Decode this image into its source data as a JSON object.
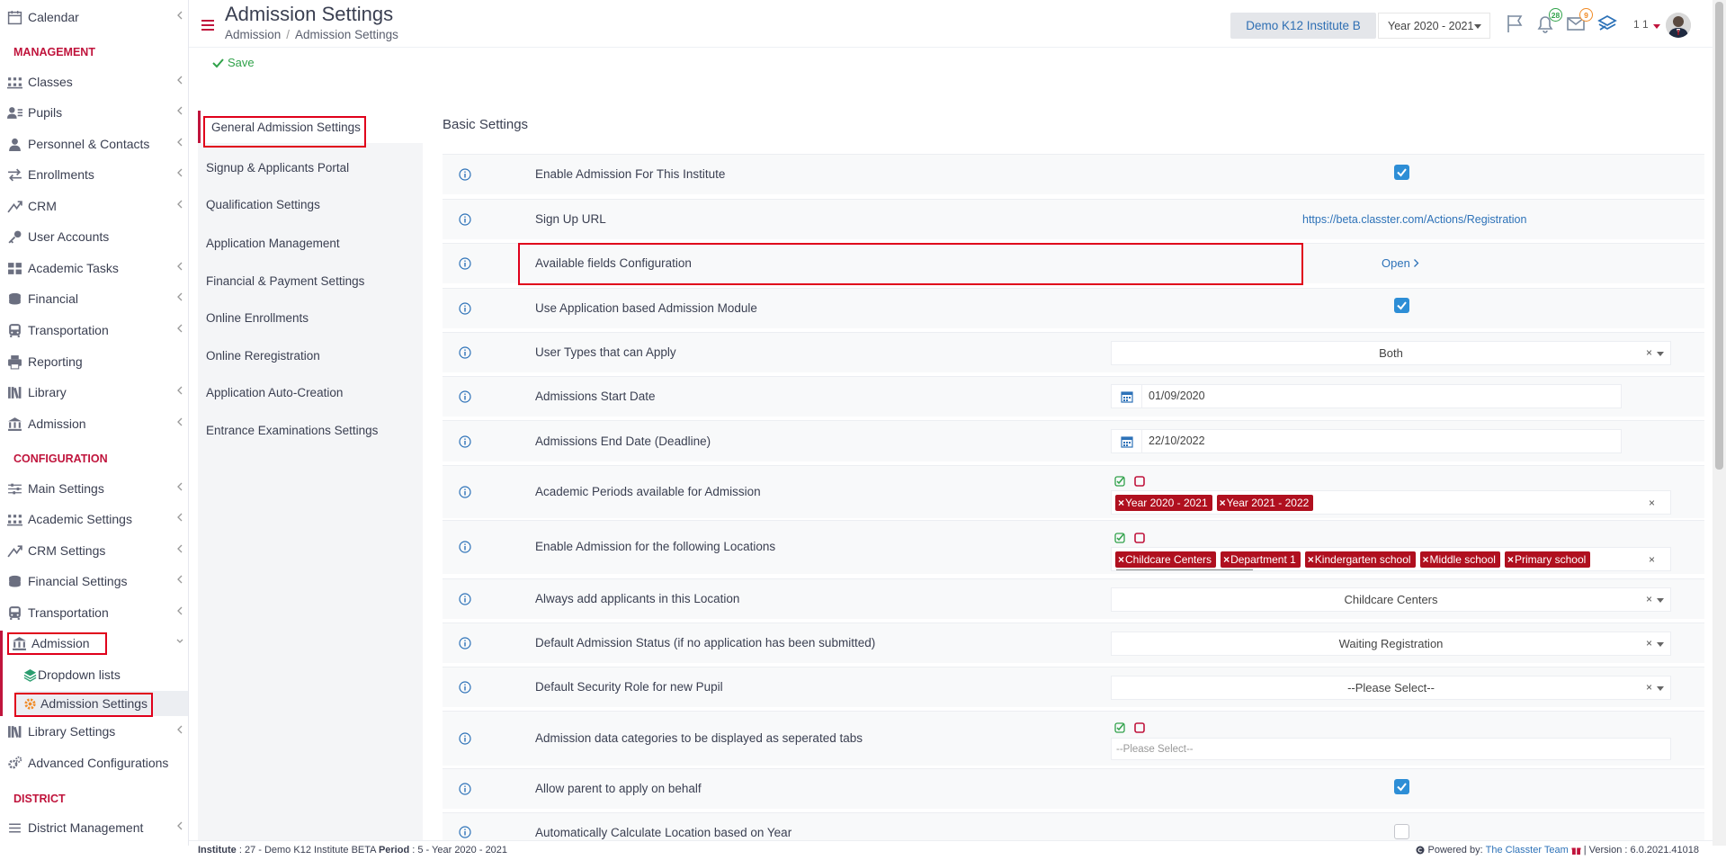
{
  "sidebar": {
    "items": [
      {
        "label": "Calendar",
        "icon": "calendar-icon",
        "chevron": true
      },
      {
        "label": "Classes",
        "icon": "classes-icon",
        "chevron": true
      },
      {
        "label": "Pupils",
        "icon": "pupils-icon",
        "chevron": true
      },
      {
        "label": "Personnel & Contacts",
        "icon": "personnel-icon",
        "chevron": true
      },
      {
        "label": "Enrollments",
        "icon": "enrollments-icon",
        "chevron": true
      },
      {
        "label": "CRM",
        "icon": "crm-icon",
        "chevron": true
      },
      {
        "label": "User Accounts",
        "icon": "key-icon",
        "chevron": false
      },
      {
        "label": "Academic Tasks",
        "icon": "academic-tasks-icon",
        "chevron": true
      },
      {
        "label": "Financial",
        "icon": "financial-icon",
        "chevron": true
      },
      {
        "label": "Transportation",
        "icon": "bus-icon",
        "chevron": true
      },
      {
        "label": "Reporting",
        "icon": "printer-icon",
        "chevron": false
      },
      {
        "label": "Library",
        "icon": "library-icon",
        "chevron": true
      },
      {
        "label": "Admission",
        "icon": "admission-icon",
        "chevron": true
      },
      {
        "label": "Main Settings",
        "icon": "main-settings-icon",
        "chevron": true
      },
      {
        "label": "Academic Settings",
        "icon": "academic-settings-icon",
        "chevron": true
      },
      {
        "label": "CRM Settings",
        "icon": "crm-settings-icon",
        "chevron": true
      },
      {
        "label": "Financial Settings",
        "icon": "financial-settings-icon",
        "chevron": true
      },
      {
        "label": "Transportation",
        "icon": "bus-icon",
        "chevron": true
      },
      {
        "label": "Admission",
        "icon": "admission-icon",
        "chevron": true
      },
      {
        "label": "Library Settings",
        "icon": "library-icon",
        "chevron": true
      },
      {
        "label": "Advanced Configurations",
        "icon": "gears-icon",
        "chevron": false
      },
      {
        "label": "District Management",
        "icon": "menu-icon",
        "chevron": true
      }
    ],
    "sub_items": [
      {
        "label": "Dropdown lists",
        "icon": "layers-icon"
      },
      {
        "label": "Admission Settings",
        "icon": "gear-icon"
      }
    ],
    "sections": [
      "MANAGEMENT",
      "CONFIGURATION",
      "DISTRICT"
    ]
  },
  "header": {
    "title": "Admission Settings",
    "breadcrumb": [
      "Admission",
      "Admission Settings"
    ],
    "institute": "Demo K12 Institute B",
    "year": "Year 2020 - 2021",
    "notifications_count": "28",
    "messages_count": "9",
    "user_short": "1 1"
  },
  "toolbar": {
    "save_label": "Save"
  },
  "settings_nav": {
    "items": [
      "General Admission Settings",
      "Signup & Applicants Portal",
      "Qualification Settings",
      "Application Management",
      "Financial & Payment Settings",
      "Online Enrollments",
      "Online Reregistration",
      "Application Auto-Creation",
      "Entrance Examinations Settings"
    ],
    "active_index": 0
  },
  "content": {
    "heading": "Basic Settings",
    "rows": [
      {
        "label": "Enable Admission For This Institute",
        "type": "checkbox",
        "checked": true
      },
      {
        "label": "Sign Up URL",
        "type": "link",
        "value": "https://beta.classter.com/Actions/Registration"
      },
      {
        "label": "Available fields Configuration",
        "type": "link",
        "value": "Open"
      },
      {
        "label": "Use Application based Admission Module",
        "type": "checkbox",
        "checked": true
      },
      {
        "label": "User Types that can Apply",
        "type": "select",
        "value": "Both"
      },
      {
        "label": "Admissions Start Date",
        "type": "date",
        "value": "01/09/2020"
      },
      {
        "label": "Admissions End Date (Deadline)",
        "type": "date",
        "value": "22/10/2022"
      },
      {
        "label": "Academic Periods available for Admission",
        "type": "tags",
        "tags": [
          "Year 2020 - 2021",
          "Year 2021 - 2022"
        ]
      },
      {
        "label": "Enable Admission for the following Locations",
        "type": "tags",
        "tags": [
          "Childcare Centers",
          "Department 1",
          "Kindergarten school",
          "Middle school",
          "Primary school"
        ]
      },
      {
        "label": "Always add applicants in this Location",
        "type": "select",
        "value": "Childcare Centers"
      },
      {
        "label": "Default Admission Status (if no application has been submitted)",
        "type": "select",
        "value": "Waiting Registration"
      },
      {
        "label": "Default Security Role for new Pupil",
        "type": "select",
        "value": "--Please Select--"
      },
      {
        "label": "Admission data categories to be displayed as seperated tabs",
        "type": "tags-empty",
        "placeholder": "--Please Select--"
      },
      {
        "label": "Allow parent to apply on behalf",
        "type": "checkbox",
        "checked": true
      },
      {
        "label": "Automatically Calculate Location based on Year",
        "type": "checkbox",
        "checked": false
      }
    ]
  },
  "footer": {
    "institute_label": "Institute",
    "institute_value": " : 27 - Demo K12 Institute BETA ",
    "period_label": "Period",
    "period_value": " : 5 - Year 2020 - 2021",
    "powered_by": "Powered by:",
    "team": "The Classter Team",
    "version": "| Version : 6.0.2021.41018"
  },
  "colors": {
    "accent": "#c0143c",
    "link": "#2d72b8",
    "checkbox": "#2d8ed6",
    "tag": "#b0101f",
    "annotation": "#e0001b"
  }
}
